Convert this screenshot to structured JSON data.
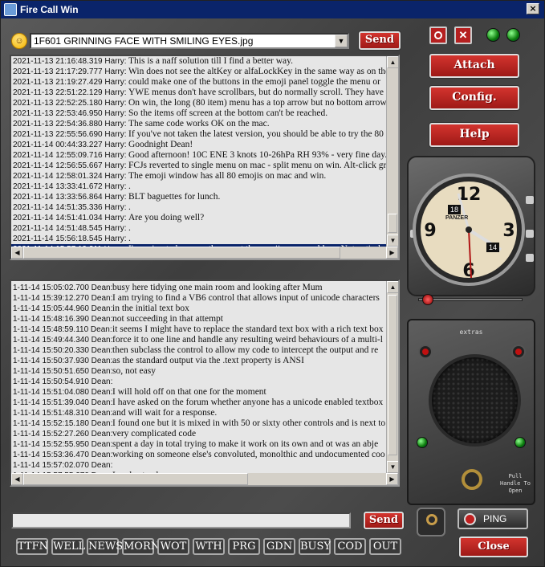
{
  "window": {
    "title": "Fire Call Win",
    "close_glyph": "×"
  },
  "emoji": {
    "icon": "grinning-face-icon",
    "selected": "1F601 GRINNING FACE WITH SMILING EYES.jpg"
  },
  "buttons": {
    "send_emoji": "Send",
    "send_text": "Send",
    "attach": "Attach",
    "config": "Config.",
    "help": "Help",
    "ping": "PING",
    "close": "Close"
  },
  "extras_label": "extras",
  "pull_handle_label": "Pull Handle To Open",
  "clock": {
    "brand": "PANZER",
    "day": "18",
    "date": "14"
  },
  "upper_log": [
    {
      "ts": "2021-11-13 21:16:48.319 Harry:",
      "msg": "This is a naff solution till I find a better way."
    },
    {
      "ts": "2021-11-13 21:17:29.777 Harry:",
      "msg": "Win does not see the altKey or alfaLockKey in the same way as on the mac"
    },
    {
      "ts": "2021-11-13 21:19:27.429 Harry:",
      "msg": "could make one of the buttons in the emoji panel toggle the menu or"
    },
    {
      "ts": "2021-11-13 22:51:22.129 Harry:",
      "msg": "YWE menus don't have scrollbars, but do normally scroll. They have a"
    },
    {
      "ts": "2021-11-13 22:52:25.180 Harry:",
      "msg": "On win, the long (80 item) menu has a top arrow but no bottom arrow"
    },
    {
      "ts": "2021-11-13 22:53:46.950 Harry:",
      "msg": "So the items off screen at the bottom can't be reached."
    },
    {
      "ts": "2021-11-13 22:54:36.880 Harry:",
      "msg": "The same code works OK on the mac."
    },
    {
      "ts": "2021-11-13 22:55:56.690 Harry:",
      "msg": "If you've not taken the latest version, you should be able to try the 80"
    },
    {
      "ts": "2021-11-14 00:44:33.227 Harry:",
      "msg": "Goodnight Dean!"
    },
    {
      "ts": "2021-11-14 12:55:09.716 Harry:",
      "msg": "Good afternoon!   10C ENE 3 knots 10-26hPa RH 93% - very fine day."
    },
    {
      "ts": "2021-11-14 12:56:55.667 Harry:",
      "msg": "FCJs reverted to single menu on mac - split menu on win. Alt-click gr"
    },
    {
      "ts": "2021-11-14 12:58:01.324 Harry:",
      "msg": "The emoji window has all 80 emojis on mac and win."
    },
    {
      "ts": "2021-11-14 13:33:41.672 Harry:",
      "msg": "."
    },
    {
      "ts": "2021-11-14 13:33:56.864 Harry:",
      "msg": "BLT baguettes for lunch."
    },
    {
      "ts": "2021-11-14 14:51:35.336 Harry:",
      "msg": "."
    },
    {
      "ts": "2021-11-14 14:51:41.034 Harry:",
      "msg": "Are you doing well?"
    },
    {
      "ts": "2021-11-14 14:51:48.545 Harry:",
      "msg": "."
    },
    {
      "ts": "2021-11-14 15:56:18.545 Harry:",
      "msg": "."
    },
    {
      "ts": "2021-11-14 15:57:19.211 Harry:",
      "msg": "I'm going to have another go at the emoji menu problem. Not entirely",
      "sel": true
    }
  ],
  "lower_log": [
    {
      "ts": "1-11-14 15:05:02.700 Dean:",
      "msg": "busy here tidying one main room and looking after Mum"
    },
    {
      "ts": "1-11-14 15:39:12.270 Dean:",
      "msg": "I am trying to find a VB6 control that allows input of unicode characters"
    },
    {
      "ts": "1-11-14 15:05:44.960 Dean:",
      "msg": "in the initial text box"
    },
    {
      "ts": "1-11-14 15:48:16.390 Dean:",
      "msg": "not succeeding in that attempt"
    },
    {
      "ts": "1-11-14 15:48:59.110 Dean:",
      "msg": "it seems I might have to replace the standard text box with a rich text box"
    },
    {
      "ts": "1-11-14 15:49:44.340 Dean:",
      "msg": "force it to one line and handle any resulting weird behaviours of a multi-l"
    },
    {
      "ts": "1-11-14 15:50:20.330 Dean:",
      "msg": "then subclass the control to allow my code to intercept the output and re"
    },
    {
      "ts": "1-11-14 15:50:37.930 Dean:",
      "msg": "as the standard output via the .text property is ANSI"
    },
    {
      "ts": "1-11-14 15:50:51.650 Dean:",
      "msg": "so, not easy"
    },
    {
      "ts": "1-11-14 15:50:54.910 Dean:",
      "msg": ""
    },
    {
      "ts": "1-11-14 15:51:04.080 Dean:",
      "msg": "I will hold off on that one for the moment"
    },
    {
      "ts": "1-11-14 15:51:39.040 Dean:",
      "msg": "I have asked on the forum whether anyone has a unicode enabled textbox"
    },
    {
      "ts": "1-11-14 15:51:48.310 Dean:",
      "msg": "and will wait for a response."
    },
    {
      "ts": "1-11-14 15:52:15.180 Dean:",
      "msg": "I found one but it is mixed in with 50 or sixty other controls and is next to"
    },
    {
      "ts": "1-11-14 15:52:27.260 Dean:",
      "msg": "very complicated code"
    },
    {
      "ts": "1-11-14 15:52:55.950 Dean:",
      "msg": "spent a day in total trying to make it work on its own and ot was an abje"
    },
    {
      "ts": "1-11-14 15:53:36.470 Dean:",
      "msg": "working on someone else's convoluted, monolthic and undocumented coo"
    },
    {
      "ts": "1-11-14 15:57:02.070 Dean:",
      "msg": ""
    },
    {
      "ts": "1-11-14 15:57:55.270 Dean:",
      "msg": "I understand"
    }
  ],
  "quick_buttons": [
    "TTFN",
    "WELL",
    "NEWS",
    "MORN",
    "WOT",
    "WTH",
    "PRG",
    "GDN",
    "BUSY",
    "COD",
    "OUT"
  ]
}
